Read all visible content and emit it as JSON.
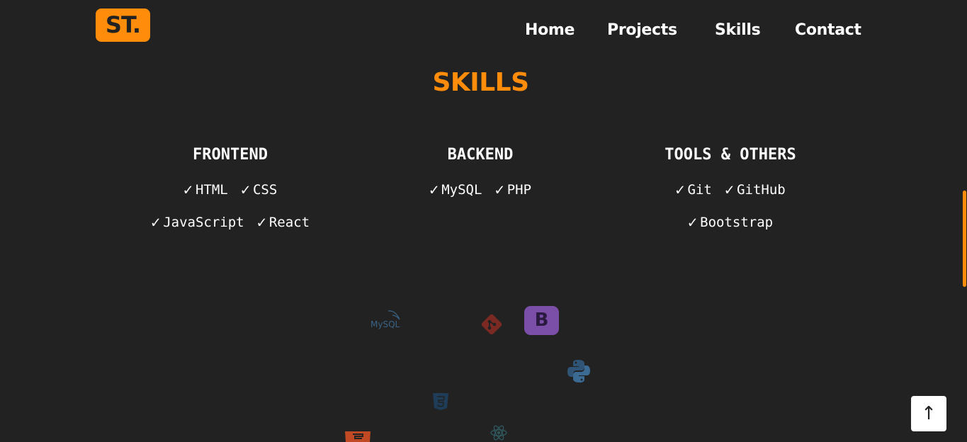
{
  "logo": {
    "text": "ST."
  },
  "nav": {
    "home": "Home",
    "projects": "Projects",
    "skills": "Skills",
    "contact": "Contact"
  },
  "section": {
    "title": "SKILLS"
  },
  "columns": {
    "frontend": {
      "heading": "FRONTEND",
      "rows": [
        [
          "HTML",
          "CSS"
        ],
        [
          "JavaScript",
          "React"
        ]
      ]
    },
    "backend": {
      "heading": "BACKEND",
      "rows": [
        [
          "MySQL",
          "PHP"
        ]
      ]
    },
    "tools": {
      "heading": "TOOLS & OTHERS",
      "rows": [
        [
          "Git",
          "GitHub"
        ],
        [
          "Bootstrap"
        ]
      ]
    }
  },
  "check_glyph": "✓",
  "floating_icons": {
    "mysql_label": "MySQL",
    "bootstrap_letter": "B"
  },
  "back_to_top": {
    "glyph": "↑"
  },
  "colors": {
    "background": "#222222",
    "accent": "#ff8c0a",
    "text": "#ffffff"
  },
  "icons": [
    "mysql-icon",
    "git-icon",
    "bootstrap-icon",
    "python-icon",
    "css3-icon",
    "react-icon",
    "html5-icon",
    "arrow-up-icon",
    "check-icon"
  ]
}
